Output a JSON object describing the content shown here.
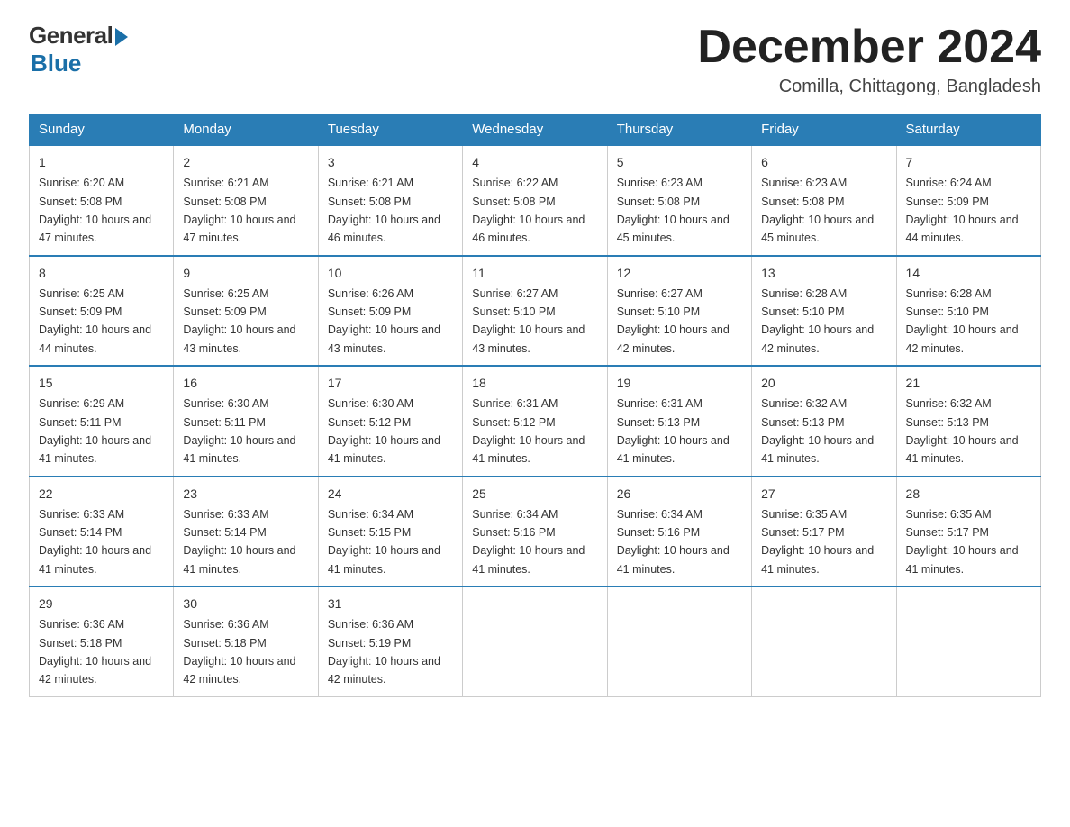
{
  "logo": {
    "general": "General",
    "blue": "Blue"
  },
  "title": "December 2024",
  "subtitle": "Comilla, Chittagong, Bangladesh",
  "headers": [
    "Sunday",
    "Monday",
    "Tuesday",
    "Wednesday",
    "Thursday",
    "Friday",
    "Saturday"
  ],
  "weeks": [
    [
      {
        "day": "1",
        "sunrise": "6:20 AM",
        "sunset": "5:08 PM",
        "daylight": "10 hours and 47 minutes."
      },
      {
        "day": "2",
        "sunrise": "6:21 AM",
        "sunset": "5:08 PM",
        "daylight": "10 hours and 47 minutes."
      },
      {
        "day": "3",
        "sunrise": "6:21 AM",
        "sunset": "5:08 PM",
        "daylight": "10 hours and 46 minutes."
      },
      {
        "day": "4",
        "sunrise": "6:22 AM",
        "sunset": "5:08 PM",
        "daylight": "10 hours and 46 minutes."
      },
      {
        "day": "5",
        "sunrise": "6:23 AM",
        "sunset": "5:08 PM",
        "daylight": "10 hours and 45 minutes."
      },
      {
        "day": "6",
        "sunrise": "6:23 AM",
        "sunset": "5:08 PM",
        "daylight": "10 hours and 45 minutes."
      },
      {
        "day": "7",
        "sunrise": "6:24 AM",
        "sunset": "5:09 PM",
        "daylight": "10 hours and 44 minutes."
      }
    ],
    [
      {
        "day": "8",
        "sunrise": "6:25 AM",
        "sunset": "5:09 PM",
        "daylight": "10 hours and 44 minutes."
      },
      {
        "day": "9",
        "sunrise": "6:25 AM",
        "sunset": "5:09 PM",
        "daylight": "10 hours and 43 minutes."
      },
      {
        "day": "10",
        "sunrise": "6:26 AM",
        "sunset": "5:09 PM",
        "daylight": "10 hours and 43 minutes."
      },
      {
        "day": "11",
        "sunrise": "6:27 AM",
        "sunset": "5:10 PM",
        "daylight": "10 hours and 43 minutes."
      },
      {
        "day": "12",
        "sunrise": "6:27 AM",
        "sunset": "5:10 PM",
        "daylight": "10 hours and 42 minutes."
      },
      {
        "day": "13",
        "sunrise": "6:28 AM",
        "sunset": "5:10 PM",
        "daylight": "10 hours and 42 minutes."
      },
      {
        "day": "14",
        "sunrise": "6:28 AM",
        "sunset": "5:10 PM",
        "daylight": "10 hours and 42 minutes."
      }
    ],
    [
      {
        "day": "15",
        "sunrise": "6:29 AM",
        "sunset": "5:11 PM",
        "daylight": "10 hours and 41 minutes."
      },
      {
        "day": "16",
        "sunrise": "6:30 AM",
        "sunset": "5:11 PM",
        "daylight": "10 hours and 41 minutes."
      },
      {
        "day": "17",
        "sunrise": "6:30 AM",
        "sunset": "5:12 PM",
        "daylight": "10 hours and 41 minutes."
      },
      {
        "day": "18",
        "sunrise": "6:31 AM",
        "sunset": "5:12 PM",
        "daylight": "10 hours and 41 minutes."
      },
      {
        "day": "19",
        "sunrise": "6:31 AM",
        "sunset": "5:13 PM",
        "daylight": "10 hours and 41 minutes."
      },
      {
        "day": "20",
        "sunrise": "6:32 AM",
        "sunset": "5:13 PM",
        "daylight": "10 hours and 41 minutes."
      },
      {
        "day": "21",
        "sunrise": "6:32 AM",
        "sunset": "5:13 PM",
        "daylight": "10 hours and 41 minutes."
      }
    ],
    [
      {
        "day": "22",
        "sunrise": "6:33 AM",
        "sunset": "5:14 PM",
        "daylight": "10 hours and 41 minutes."
      },
      {
        "day": "23",
        "sunrise": "6:33 AM",
        "sunset": "5:14 PM",
        "daylight": "10 hours and 41 minutes."
      },
      {
        "day": "24",
        "sunrise": "6:34 AM",
        "sunset": "5:15 PM",
        "daylight": "10 hours and 41 minutes."
      },
      {
        "day": "25",
        "sunrise": "6:34 AM",
        "sunset": "5:16 PM",
        "daylight": "10 hours and 41 minutes."
      },
      {
        "day": "26",
        "sunrise": "6:34 AM",
        "sunset": "5:16 PM",
        "daylight": "10 hours and 41 minutes."
      },
      {
        "day": "27",
        "sunrise": "6:35 AM",
        "sunset": "5:17 PM",
        "daylight": "10 hours and 41 minutes."
      },
      {
        "day": "28",
        "sunrise": "6:35 AM",
        "sunset": "5:17 PM",
        "daylight": "10 hours and 41 minutes."
      }
    ],
    [
      {
        "day": "29",
        "sunrise": "6:36 AM",
        "sunset": "5:18 PM",
        "daylight": "10 hours and 42 minutes."
      },
      {
        "day": "30",
        "sunrise": "6:36 AM",
        "sunset": "5:18 PM",
        "daylight": "10 hours and 42 minutes."
      },
      {
        "day": "31",
        "sunrise": "6:36 AM",
        "sunset": "5:19 PM",
        "daylight": "10 hours and 42 minutes."
      },
      null,
      null,
      null,
      null
    ]
  ],
  "labels": {
    "sunrise": "Sunrise:",
    "sunset": "Sunset:",
    "daylight": "Daylight:"
  }
}
